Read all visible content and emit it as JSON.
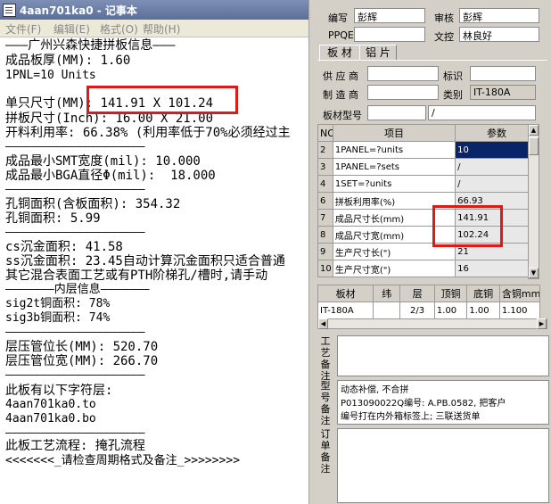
{
  "notepad": {
    "title": "4aan701ka0 - 记事本",
    "menu": [
      "文件(F)",
      "编辑(E)",
      "格式(O)",
      "帮助(H)"
    ],
    "lines": [
      "———广州兴森快捷拼板信息———",
      "成品板厚(MM): 1.60",
      "1PNL=10 Units",
      "单只尺寸(MM): 141.91 X 101.24",
      "拼板尺寸(Inch): 16.00 X 21.00",
      "开料利用率: 66.38% (利用率低于70%必须经过主",
      "————————————————————",
      "成品最小SMT宽度(mil): 10.000",
      "成品最小BGA直径Φ(mil):  18.000",
      "————————————————————",
      "孔铜面积(含板面积): 354.32",
      "孔铜面积: 5.99",
      "————————————————————",
      "cs沉金面积: 41.58",
      "ss沉金面积: 23.45自动计算沉金面积只适合普通",
      "其它混合表面工艺或有PTH阶梯孔/槽时,请手动",
      "———————内层信息———————",
      "sig2t铜面积: 78%",
      "sig3b铜面积: 74%",
      "————————————————————",
      "层压管位长(MM): 520.70",
      "层压管位宽(MM): 266.70",
      "————————————————————",
      "此板有以下字符层:",
      "4aan701ka0.to",
      "4aan701ka0.bo",
      "————————————————————",
      "此板工艺流程: 掩孔流程",
      "<<<<<<<_请检查周期格式及备注_>>>>>>>>"
    ]
  },
  "form": {
    "editor_label": "编写",
    "editor_value": "彭辉",
    "reviewer_label": "审核",
    "reviewer_value": "彭辉",
    "ppqe_label": "PPQE",
    "ppqe_value": "",
    "doc_label": "文控",
    "doc_value": "林良好",
    "tabs": [
      "板 材",
      "铝 片"
    ],
    "supplier_label": "供 应 商",
    "mark_label": "标识",
    "maker_label": "制 造 商",
    "type_label": "类别",
    "type_value": "IT-180A",
    "model_label": "板材型号",
    "model_value": "/",
    "grid1": {
      "headers": [
        "NO",
        "项目",
        "参数"
      ],
      "rows": [
        [
          "2",
          "1PANEL=?units",
          "10"
        ],
        [
          "3",
          "1PANEL=?sets",
          "/"
        ],
        [
          "4",
          "1SET=?units",
          "/"
        ],
        [
          "6",
          "拼板利用率(%)",
          "66.93"
        ],
        [
          "7",
          "成品尺寸长(mm)",
          "141.91"
        ],
        [
          "8",
          "成品尺寸宽(mm)",
          "102.24"
        ],
        [
          "9",
          "生产尺寸长(\")",
          "21"
        ],
        [
          "10",
          "生产尺寸宽(\")",
          "16"
        ]
      ]
    },
    "grid2": {
      "headers": [
        "板材",
        "纬",
        "层",
        "顶铜",
        "底铜",
        "含铜mm"
      ],
      "row": [
        "IT-180A",
        "",
        "2/3",
        "1.00",
        "1.00",
        "1.100"
      ]
    },
    "process_note_label": "工艺备注",
    "process_note": "",
    "model_note_label": "型号备注",
    "model_note_lines": [
      "动态补偿, 不合拼",
      "P013090022Q编号: A.PB.0582, 把客户",
      "编号打在内外箱标签上; 三联送货单"
    ],
    "order_note_label": "订单备注",
    "order_note": ""
  },
  "colors": {
    "highlight": "#e01818",
    "selected_cell": "#0a246a"
  }
}
